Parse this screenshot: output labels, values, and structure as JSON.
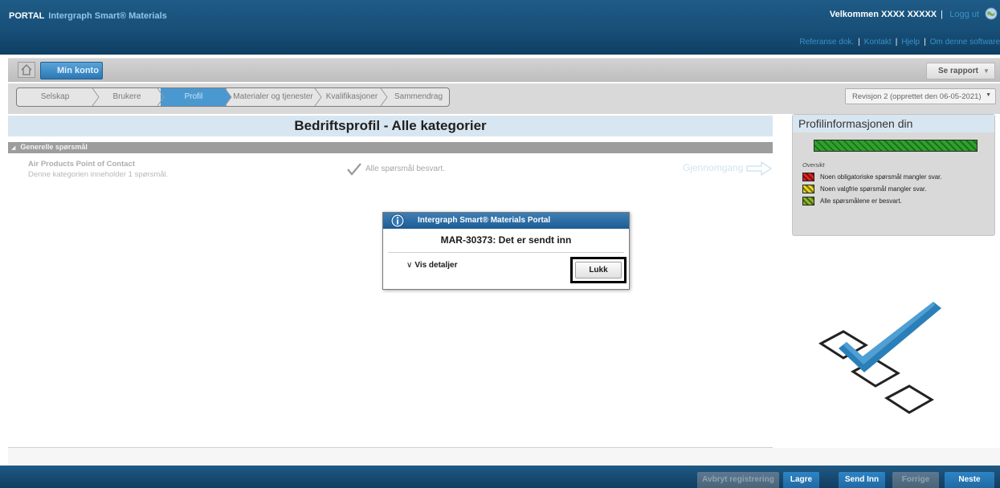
{
  "header": {
    "brand_prefix": "PORTAL",
    "product": "Intergraph Smart® Materials",
    "welcome": "Velkommen XXXX XXXXX",
    "separator": "|",
    "logout": "Logg ut",
    "links": [
      "Referanse dok.",
      "Kontakt",
      "Hjelp",
      "Om denne software"
    ]
  },
  "account_bar": {
    "tab_label": "Min konto",
    "report_button": "Se rapport"
  },
  "wizard": {
    "steps": [
      "Selskap",
      "Brukere",
      "Profil",
      "Materialer og tjenester",
      "Kvalifikasjoner",
      "Sammendrag"
    ],
    "active_step": "Profil",
    "revision": "Revisjon 2 (opprettet den 06-05-2021)"
  },
  "main": {
    "title": "Bedriftsprofil - Alle kategorier",
    "category_group": "Generelle spørsmål",
    "category": {
      "title": "Air Products Point of Contact",
      "description": "Denne kategorien inneholder 1 spørsmål.",
      "status": "Alle spørsmål besvart.",
      "review_link": "Gjennomgang"
    }
  },
  "sidebar": {
    "title": "Profilinformasjonen din",
    "progress": 1.0,
    "legend_title": "Oversikt",
    "legend": [
      {
        "color": "#e12424",
        "label": "Noen obligatoriske spørsmål mangler svar."
      },
      {
        "color": "#e6d81f",
        "label": "Noen valgfrie spørsmål mangler svar."
      },
      {
        "color": "#8eb82a",
        "label": "Alle spørsmålene er besvart."
      }
    ]
  },
  "footer": {
    "buttons": [
      "Avbryt registrering",
      "Lagre",
      "Send Inn",
      "Forrige",
      "Neste"
    ]
  },
  "modal": {
    "title": "Intergraph Smart® Materials Portal",
    "message": "MAR-30373: Det er sendt inn",
    "details_label": "Vis detaljer",
    "close_label": "Lukk"
  },
  "colors": {
    "header_blue": "#174f78",
    "active_step": "#4a98d0",
    "progress_green": "#2da22b"
  }
}
